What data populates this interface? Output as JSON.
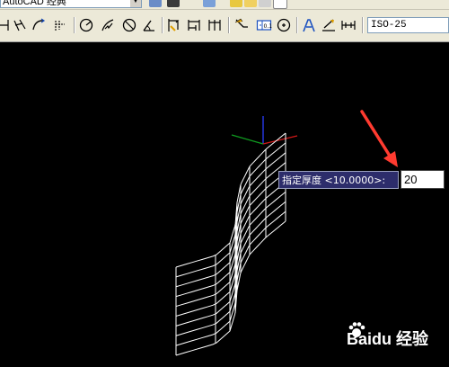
{
  "workspace": {
    "value": "AutoCAD 经典"
  },
  "dim_style": {
    "value": "ISO-25"
  },
  "prompt": {
    "label": "指定厚度 <10.0000>:",
    "input_value": "20"
  },
  "watermark": {
    "text": "Baidu 经验"
  },
  "colors": {
    "canvas": "#000000",
    "toolbar": "#ece9d8",
    "tooltip": "#2d2d6b",
    "arrow": "#ff3b30",
    "wire": "#ffffff"
  },
  "icons": [
    "dim-linear-icon",
    "dim-aligned-icon",
    "dim-arc-icon",
    "dim-ordinate-icon",
    "dim-radius-icon",
    "dim-jogged-icon",
    "dim-diameter-icon",
    "dim-angular-icon",
    "quick-dim-icon",
    "dim-baseline-icon",
    "dim-continue-icon",
    "quick-leader-icon",
    "tolerance-icon",
    "center-mark-icon",
    "dim-edit-icon",
    "dim-text-edit-icon",
    "dim-update-icon"
  ]
}
